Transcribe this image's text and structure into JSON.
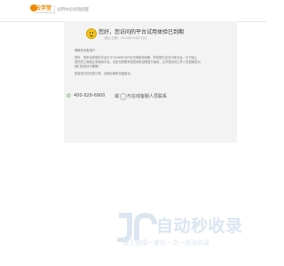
{
  "header": {
    "brand": "云学堂",
    "brand_sub": "yunxuetang.cn",
    "title": "试用体验到期提醒"
  },
  "notice": {
    "title": "您好，您访问的平台试用体验已到期",
    "date": "(截止日期：2016年05月03日)",
    "lines": [
      "尊敬的贵客用户：",
      "您好，您申请体验的平台已于2016年5月3日试用体验到期，您将暂无法访问该平台。为了能让",
      "您的员工继续正常使用平台，请您尽快联系您的销售经理进行续费，云学堂全体工作人员感谢您对",
      "我们的支持与理解！",
      "如若您已经完成订单，请稍后刷新页面重试。"
    ],
    "phone": "400-928-6900",
    "separator": "或",
    "online_link": "与在线客服人员联系"
  },
  "watermark": {
    "title": "自动秒收录",
    "slogan": "做上链接一来访一次一自动收录"
  }
}
